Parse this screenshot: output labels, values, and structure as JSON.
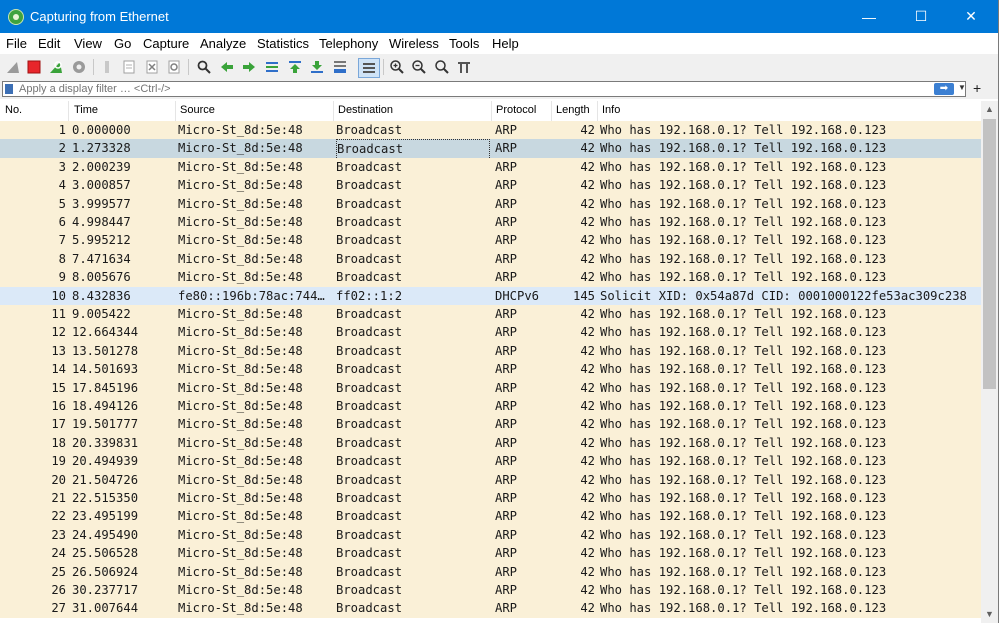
{
  "window": {
    "title": "Capturing from Ethernet",
    "minimize": "—",
    "maximize": "☐",
    "close": "✕"
  },
  "menu": [
    "File",
    "Edit",
    "View",
    "Go",
    "Capture",
    "Analyze",
    "Statistics",
    "Telephony",
    "Wireless",
    "Tools",
    "Help"
  ],
  "toolbar": {
    "icons": [
      "shark-fin-start-icon",
      "stop-capture-icon",
      "restart-capture-icon",
      "capture-options-icon",
      "open-file-icon",
      "save-file-icon",
      "close-file-icon",
      "reload-file-icon",
      "find-packet-icon",
      "go-back-icon",
      "go-forward-icon",
      "go-to-packet-icon",
      "go-first-icon",
      "go-last-icon",
      "auto-scroll-icon",
      "colorize-icon",
      "zoom-in-icon",
      "zoom-out-icon",
      "zoom-normal-icon",
      "resize-columns-icon"
    ],
    "colors": {
      "stop": "#e8262b",
      "green": "#3aa33a",
      "blue": "#2f6fc9"
    }
  },
  "filter": {
    "placeholder": "Apply a display filter … <Ctrl-/>",
    "apply": "➡",
    "dropdown": "▼",
    "add": "+"
  },
  "columns": {
    "no": "No.",
    "time": "Time",
    "source": "Source",
    "destination": "Destination",
    "protocol": "Protocol",
    "length": "Length",
    "info": "Info"
  },
  "packets": [
    {
      "no": "1",
      "time": "0.000000",
      "source": "Micro-St_8d:5e:48",
      "destination": "Broadcast",
      "protocol": "ARP",
      "length": "42",
      "info": "Who has 192.168.0.1? Tell 192.168.0.123"
    },
    {
      "no": "2",
      "time": "1.273328",
      "source": "Micro-St_8d:5e:48",
      "destination": "Broadcast",
      "protocol": "ARP",
      "length": "42",
      "info": "Who has 192.168.0.1? Tell 192.168.0.123"
    },
    {
      "no": "3",
      "time": "2.000239",
      "source": "Micro-St_8d:5e:48",
      "destination": "Broadcast",
      "protocol": "ARP",
      "length": "42",
      "info": "Who has 192.168.0.1? Tell 192.168.0.123"
    },
    {
      "no": "4",
      "time": "3.000857",
      "source": "Micro-St_8d:5e:48",
      "destination": "Broadcast",
      "protocol": "ARP",
      "length": "42",
      "info": "Who has 192.168.0.1? Tell 192.168.0.123"
    },
    {
      "no": "5",
      "time": "3.999577",
      "source": "Micro-St_8d:5e:48",
      "destination": "Broadcast",
      "protocol": "ARP",
      "length": "42",
      "info": "Who has 192.168.0.1? Tell 192.168.0.123"
    },
    {
      "no": "6",
      "time": "4.998447",
      "source": "Micro-St_8d:5e:48",
      "destination": "Broadcast",
      "protocol": "ARP",
      "length": "42",
      "info": "Who has 192.168.0.1? Tell 192.168.0.123"
    },
    {
      "no": "7",
      "time": "5.995212",
      "source": "Micro-St_8d:5e:48",
      "destination": "Broadcast",
      "protocol": "ARP",
      "length": "42",
      "info": "Who has 192.168.0.1? Tell 192.168.0.123"
    },
    {
      "no": "8",
      "time": "7.471634",
      "source": "Micro-St_8d:5e:48",
      "destination": "Broadcast",
      "protocol": "ARP",
      "length": "42",
      "info": "Who has 192.168.0.1? Tell 192.168.0.123"
    },
    {
      "no": "9",
      "time": "8.005676",
      "source": "Micro-St_8d:5e:48",
      "destination": "Broadcast",
      "protocol": "ARP",
      "length": "42",
      "info": "Who has 192.168.0.1? Tell 192.168.0.123"
    },
    {
      "no": "10",
      "time": "8.432836",
      "source": "fe80::196b:78ac:744…",
      "destination": "ff02::1:2",
      "protocol": "DHCPv6",
      "length": "145",
      "info": "Solicit XID: 0x54a87d CID: 0001000122fe53ac309c238"
    },
    {
      "no": "11",
      "time": "9.005422",
      "source": "Micro-St_8d:5e:48",
      "destination": "Broadcast",
      "protocol": "ARP",
      "length": "42",
      "info": "Who has 192.168.0.1? Tell 192.168.0.123"
    },
    {
      "no": "12",
      "time": "12.664344",
      "source": "Micro-St_8d:5e:48",
      "destination": "Broadcast",
      "protocol": "ARP",
      "length": "42",
      "info": "Who has 192.168.0.1? Tell 192.168.0.123"
    },
    {
      "no": "13",
      "time": "13.501278",
      "source": "Micro-St_8d:5e:48",
      "destination": "Broadcast",
      "protocol": "ARP",
      "length": "42",
      "info": "Who has 192.168.0.1? Tell 192.168.0.123"
    },
    {
      "no": "14",
      "time": "14.501693",
      "source": "Micro-St_8d:5e:48",
      "destination": "Broadcast",
      "protocol": "ARP",
      "length": "42",
      "info": "Who has 192.168.0.1? Tell 192.168.0.123"
    },
    {
      "no": "15",
      "time": "17.845196",
      "source": "Micro-St_8d:5e:48",
      "destination": "Broadcast",
      "protocol": "ARP",
      "length": "42",
      "info": "Who has 192.168.0.1? Tell 192.168.0.123"
    },
    {
      "no": "16",
      "time": "18.494126",
      "source": "Micro-St_8d:5e:48",
      "destination": "Broadcast",
      "protocol": "ARP",
      "length": "42",
      "info": "Who has 192.168.0.1? Tell 192.168.0.123"
    },
    {
      "no": "17",
      "time": "19.501777",
      "source": "Micro-St_8d:5e:48",
      "destination": "Broadcast",
      "protocol": "ARP",
      "length": "42",
      "info": "Who has 192.168.0.1? Tell 192.168.0.123"
    },
    {
      "no": "18",
      "time": "20.339831",
      "source": "Micro-St_8d:5e:48",
      "destination": "Broadcast",
      "protocol": "ARP",
      "length": "42",
      "info": "Who has 192.168.0.1? Tell 192.168.0.123"
    },
    {
      "no": "19",
      "time": "20.494939",
      "source": "Micro-St_8d:5e:48",
      "destination": "Broadcast",
      "protocol": "ARP",
      "length": "42",
      "info": "Who has 192.168.0.1? Tell 192.168.0.123"
    },
    {
      "no": "20",
      "time": "21.504726",
      "source": "Micro-St_8d:5e:48",
      "destination": "Broadcast",
      "protocol": "ARP",
      "length": "42",
      "info": "Who has 192.168.0.1? Tell 192.168.0.123"
    },
    {
      "no": "21",
      "time": "22.515350",
      "source": "Micro-St_8d:5e:48",
      "destination": "Broadcast",
      "protocol": "ARP",
      "length": "42",
      "info": "Who has 192.168.0.1? Tell 192.168.0.123"
    },
    {
      "no": "22",
      "time": "23.495199",
      "source": "Micro-St_8d:5e:48",
      "destination": "Broadcast",
      "protocol": "ARP",
      "length": "42",
      "info": "Who has 192.168.0.1? Tell 192.168.0.123"
    },
    {
      "no": "23",
      "time": "24.495490",
      "source": "Micro-St_8d:5e:48",
      "destination": "Broadcast",
      "protocol": "ARP",
      "length": "42",
      "info": "Who has 192.168.0.1? Tell 192.168.0.123"
    },
    {
      "no": "24",
      "time": "25.506528",
      "source": "Micro-St_8d:5e:48",
      "destination": "Broadcast",
      "protocol": "ARP",
      "length": "42",
      "info": "Who has 192.168.0.1? Tell 192.168.0.123"
    },
    {
      "no": "25",
      "time": "26.506924",
      "source": "Micro-St_8d:5e:48",
      "destination": "Broadcast",
      "protocol": "ARP",
      "length": "42",
      "info": "Who has 192.168.0.1? Tell 192.168.0.123"
    },
    {
      "no": "26",
      "time": "30.237717",
      "source": "Micro-St_8d:5e:48",
      "destination": "Broadcast",
      "protocol": "ARP",
      "length": "42",
      "info": "Who has 192.168.0.1? Tell 192.168.0.123"
    },
    {
      "no": "27",
      "time": "31.007644",
      "source": "Micro-St_8d:5e:48",
      "destination": "Broadcast",
      "protocol": "ARP",
      "length": "42",
      "info": "Who has 192.168.0.1? Tell 192.168.0.123"
    }
  ],
  "selection": {
    "selected_row": "2",
    "highlight_row": "10"
  },
  "colors": {
    "arp_row": "#faf0d7",
    "selected_row": "#c8d8e0",
    "dhcp_row": "#dbe9f8",
    "titlebar": "#0078d7"
  },
  "scrollbar": {
    "up": "▲",
    "down": "▼"
  }
}
